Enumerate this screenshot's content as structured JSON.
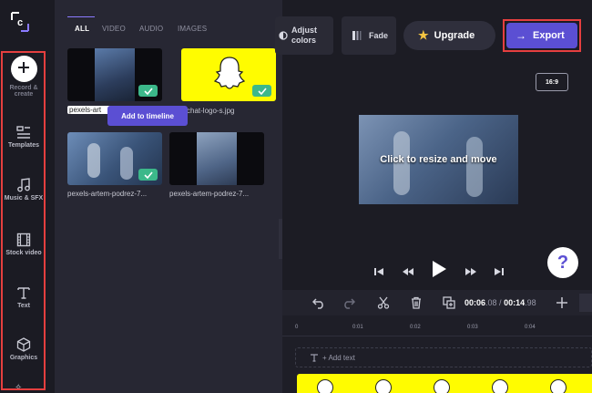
{
  "logo": "c",
  "rail": [
    {
      "label": "Record & create",
      "icon": "plus-icon"
    },
    {
      "label": "Templates",
      "icon": "templates-icon"
    },
    {
      "label": "Music & SFX",
      "icon": "music-note-icon"
    },
    {
      "label": "Stock video",
      "icon": "film-icon"
    },
    {
      "label": "Text",
      "icon": "text-icon"
    },
    {
      "label": "Graphics",
      "icon": "cube-icon"
    }
  ],
  "library": {
    "tabs": [
      "ALL",
      "VIDEO",
      "AUDIO",
      "IMAGES"
    ],
    "active_tab": "ALL",
    "items": [
      {
        "name": "pexels-art",
        "added": true
      },
      {
        "name": "chat-logo-s.jpg",
        "added": true
      },
      {
        "name": "pexels-artem-podrez-7...",
        "added": true
      },
      {
        "name": "pexels-artem-podrez-7...",
        "added": false
      }
    ],
    "tooltip": "Add to timeline"
  },
  "toolbar": {
    "adjust_colors": "Adjust colors",
    "adjust_line1": "Adjust",
    "adjust_line2": "colors",
    "fade": "Fade",
    "upgrade": "Upgrade",
    "export": "Export"
  },
  "preview": {
    "aspect": "16:9",
    "overlay_text": "Click to resize and move",
    "help": "?"
  },
  "timeline": {
    "current_time": "00:06",
    "current_frac": ".08",
    "separator": " / ",
    "total_time": "00:14",
    "total_frac": ".98",
    "ticks": [
      "0",
      "0:01",
      "0:02",
      "0:03",
      "0:04"
    ],
    "add_text": "+ Add text"
  },
  "colors": {
    "accent": "#5b4fd3",
    "export_outline": "#e53f3f",
    "check": "#3cb88a",
    "snapchat": "#fffc00"
  }
}
